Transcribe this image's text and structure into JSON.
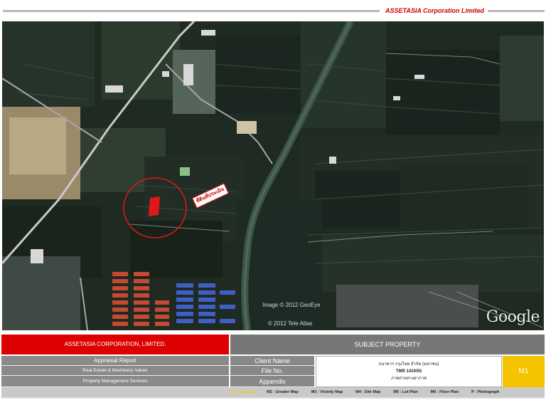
{
  "header": {
    "company": "ASSETASIA Corporation Limited"
  },
  "map": {
    "site_label": "ที่ดินที่ประเมิน",
    "watermarks": [
      "Image © 2012 GeoEye",
      "© 2012 Tele Atlas"
    ],
    "logo_text": "Google"
  },
  "footer": {
    "company_name": "ASSETASIA CORPORATION, LIMITED.",
    "subject_heading": "SUBJECT PROPERTY",
    "services": [
      "Appraisal Report",
      "Real Estate & Machinery Valuer",
      "Property Management Services"
    ],
    "labels": [
      "Client Name",
      "File No.",
      "Appendix"
    ],
    "subject_lines": [
      "ธนาคาร กรุงไทย จำกัด (มหาชน)",
      "TMR 1419/55",
      "ภาพถ่ายทางอากาศ"
    ],
    "map_number": "M1",
    "nav": [
      "M1 : Area Map",
      "M2 : Greater Map",
      "M3 : Vicinity Map",
      "M4 : Site Map",
      "M5 : Lot Plan",
      "M6 : Floor Plan",
      "P : Photograph"
    ]
  },
  "colors": {
    "brand_red": "#dd0000",
    "accent_yellow": "#f5c400",
    "panel_grey": "#8a8a8a"
  }
}
